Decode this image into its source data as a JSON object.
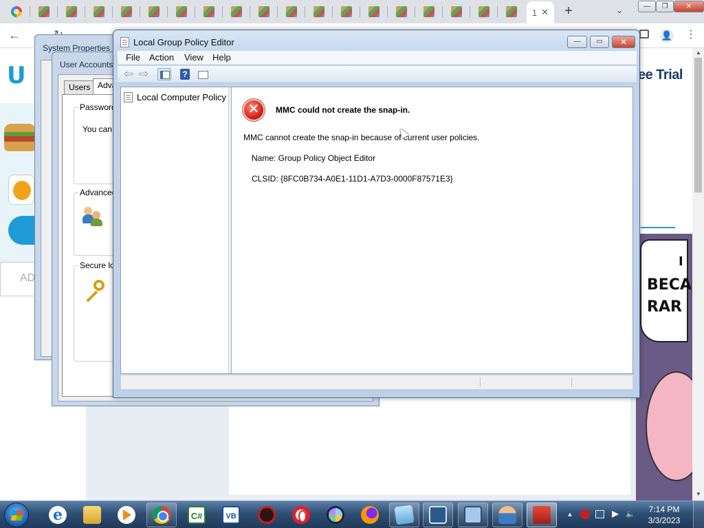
{
  "browser": {
    "active_tab_label": "1",
    "tab_close_glyph": "✕",
    "new_tab_glyph": "+",
    "tab_search_glyph": "⌄",
    "window_controls": {
      "minimize": "—",
      "maximize": "❐",
      "close": "✕"
    },
    "nav": {
      "back": "←",
      "forward": "→",
      "reload": "↻"
    },
    "menu_glyph": "⋮",
    "profile_glyph": "👤",
    "scroll_up": "▲",
    "scroll_down": "▼"
  },
  "website": {
    "header_text": "ee Trial",
    "ad_label": "AD",
    "comic_words": [
      "I",
      "BECA",
      "RAR"
    ]
  },
  "system_properties": {
    "title": "System Properties"
  },
  "user_accounts": {
    "title": "User Accounts",
    "tabs": [
      {
        "label": "Users"
      },
      {
        "label": "Adva"
      }
    ],
    "groups": [
      {
        "title": "Password",
        "text": "You can"
      },
      {
        "title": "Advanced"
      },
      {
        "title": "Secure log"
      }
    ]
  },
  "gpe": {
    "title": "Local Group Policy Editor",
    "controls": {
      "minimize": "—",
      "maximize": "▭",
      "close": "✕"
    },
    "menu": [
      {
        "label": "File"
      },
      {
        "label": "Action"
      },
      {
        "label": "View"
      },
      {
        "label": "Help"
      }
    ],
    "toolbar": {
      "back": "⇦",
      "forward": "⇨",
      "help": "?"
    },
    "tree": {
      "root_label": "Local Computer Policy"
    },
    "error": {
      "icon_glyph": "✕",
      "title": "MMC could not create the snap-in.",
      "message": "MMC cannot create the snap-in because of current user policies.",
      "name_line": "Name: Group Policy Object Editor",
      "clsid_line": "CLSID: {8FC0B734-A0E1-11D1-A7D3-0000F87571E3}"
    }
  },
  "taskbar": {
    "apps": [
      {
        "name": "internet-explorer",
        "glyph": "e"
      },
      {
        "name": "windows-explorer",
        "glyph": ""
      },
      {
        "name": "media-player",
        "glyph": ""
      },
      {
        "name": "chrome",
        "glyph": ""
      },
      {
        "name": "csharp-ide",
        "glyph": "C#"
      },
      {
        "name": "vb-ide",
        "glyph": "VB"
      },
      {
        "name": "antivirus",
        "glyph": ""
      },
      {
        "name": "opera",
        "glyph": ""
      },
      {
        "name": "brave",
        "glyph": ""
      },
      {
        "name": "firefox",
        "glyph": ""
      },
      {
        "name": "notepad",
        "glyph": ""
      },
      {
        "name": "network-center",
        "glyph": ""
      },
      {
        "name": "system-monitor",
        "glyph": ""
      },
      {
        "name": "user-accounts",
        "glyph": ""
      },
      {
        "name": "toolbox",
        "glyph": ""
      }
    ],
    "tray": {
      "expand": "▲",
      "volume": "🔈"
    },
    "clock": {
      "time": "7:14 PM",
      "date": "3/3/2023"
    }
  }
}
